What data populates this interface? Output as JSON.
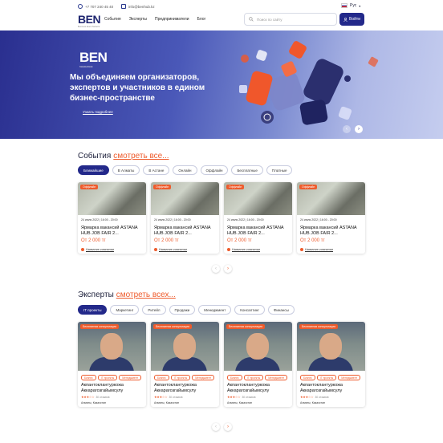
{
  "topbar": {
    "phone": "+7 707 240 45 40",
    "email": "info@benhub.kz",
    "logo": "BEN",
    "logo_sub": "Business Event Network",
    "nav": [
      "События",
      "Эксперты",
      "Предприниматели",
      "Блог"
    ],
    "search_placeholder": "Поиск по сайту",
    "login": "Войти",
    "lang": "Рус"
  },
  "hero": {
    "logo": "BEN",
    "logo_sub": "Business Event Network",
    "headline": "Мы объединяем организаторов, экспертов и участников в едином бизнес-пространстве",
    "more": "Узнать подробнее"
  },
  "events": {
    "title": "События",
    "link": "смотреть все...",
    "filters": [
      "Ближайшие",
      "В Алматы",
      "В Астане",
      "Онлайн",
      "Оффлайн",
      "Бесплатные",
      "Платные"
    ],
    "cards": [
      {
        "badge": "Оффлайн",
        "date": "24 июля 2022 | 16:00 - 20:00",
        "title": "Ярмарка вакансий ASTANA HUB JOB FAIR 2...",
        "price": "От 2 000 тг",
        "org": "Название компании"
      },
      {
        "badge": "Оффлайн",
        "date": "24 июля 2022 | 16:00 - 20:00",
        "title": "Ярмарка вакансий ASTANA HUB JOB FAIR 2...",
        "price": "От 2 000 тг",
        "org": "Название компании"
      },
      {
        "badge": "Оффлайн",
        "date": "24 июля 2022 | 16:00 - 20:00",
        "title": "Ярмарка вакансий ASTANA HUB JOB FAIR 2...",
        "price": "От 2 000 тг",
        "org": "Название компании"
      },
      {
        "badge": "Оффлайн",
        "date": "24 июля 2022 | 16:00 - 20:00",
        "title": "Ярмарка вакансий ASTANA HUB JOB FAIR 2...",
        "price": "От 2 000 тг",
        "org": "Название компании"
      }
    ]
  },
  "experts": {
    "title": "Эксперты",
    "link": "смотреть всех...",
    "filters": [
      "IT проекты",
      "Маркетинг",
      "Ритейл",
      "Продажи",
      "Менеджмент",
      "Консалтинг",
      "Финансы"
    ],
    "cards": [
      {
        "badge": "Бесплатная консультация",
        "tags": [
          "Бизнес",
          "IT проекты",
          "Менеджмент"
        ],
        "name": "Акпантоклантуркожа Аккарагозгайымсулу",
        "reviews": "30 отзывов",
        "location": "Алматы, Казахстан"
      },
      {
        "badge": "Бесплатная консультация",
        "tags": [
          "Бизнес",
          "IT проекты",
          "Менеджмент"
        ],
        "name": "Акпантоклантуркожа Аккарагозгайымсулу",
        "reviews": "30 отзывов",
        "location": "Алматы, Казахстан"
      },
      {
        "badge": "Бесплатная консультация",
        "tags": [
          "Бизнес",
          "IT проекты",
          "Менеджмент"
        ],
        "name": "Акпантоклантуркожа Аккарагозгайымсулу",
        "reviews": "30 отзывов",
        "location": "Алматы, Казахстан"
      },
      {
        "badge": "Бесплатная консультация",
        "tags": [
          "Бизнес",
          "IT проекты",
          "Менеджмент"
        ],
        "name": "Акпантоклантуркожа Аккарагозгайымсулу",
        "reviews": "30 отзывов",
        "location": "Алматы, Казахстан"
      }
    ]
  },
  "colors": {
    "brand": "#23298a",
    "accent": "#ee5b2c"
  }
}
